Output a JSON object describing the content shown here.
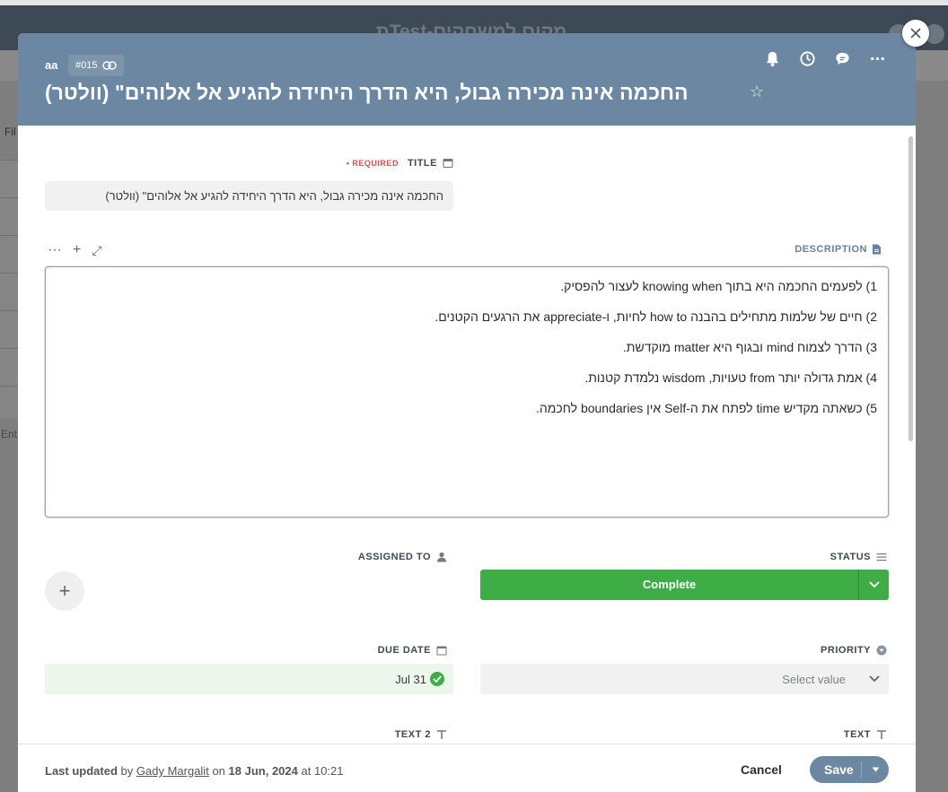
{
  "background": {
    "app_title": "מקום למשחקים-Testת",
    "filter_text": "Fil",
    "enter_text": "Ent"
  },
  "modal": {
    "project": "aa",
    "task_id": "#015",
    "title": "החכמה אינה מכירה גבול, היא הדרך היחידה להגיע אל אלוהים\" (וולטר)",
    "header_icons": [
      "bell-icon",
      "clock-icon",
      "comment-icon",
      "more-icon"
    ],
    "fields": {
      "title_label": "TITLE",
      "required_label": "• REQUIRED",
      "title_value": "החכמה אינה מכירה גבול, היא הדרך היחידה להגיע אל אלוהים\" (וולטר)",
      "description_label": "DESCRIPTION",
      "description_lines": [
        "1) לפעמים החכמה היא בתוך knowing when לעצור להפסיק.",
        "2) חיים של שלמות מתחילים בהבנה how to לחיות, ו-appreciate את הרגעים הקטנים.",
        "3) הדרך לצמוח mind ובגוף  היא matter מוקדשת.",
        "4) אמת גדולה יותר from טעויות, wisdom נלמדת קטנות.",
        "5) כשאתה מקדיש time לפתח את ה-Self אין boundaries לחכמה."
      ],
      "assigned_label": "ASSIGNED TO",
      "status_label": "STATUS",
      "status_value": "Complete",
      "due_label": "DUE DATE",
      "due_value": "Jul 31",
      "priority_label": "PRIORITY",
      "priority_placeholder": "Select value",
      "text2_label": "TEXT 2",
      "text_label": "TEXT"
    },
    "footer": {
      "last_updated": "Last updated",
      "by": "by",
      "user": "Gady Margalit",
      "on": "on",
      "date": "18 Jun, 2024",
      "at": "at 10:21",
      "cancel": "Cancel",
      "save": "Save"
    }
  },
  "colors": {
    "header": "#6b87a1",
    "status_complete": "#3ead45",
    "required": "#e44b4b"
  }
}
